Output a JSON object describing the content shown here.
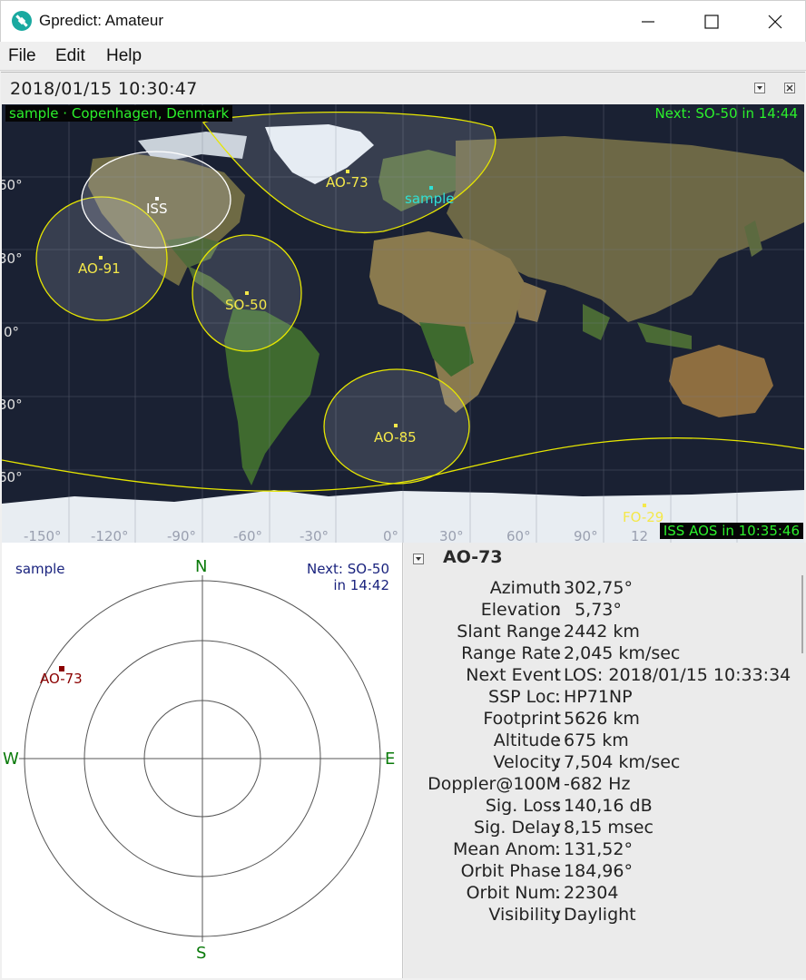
{
  "window": {
    "title": "Gpredict: Amateur"
  },
  "menu": [
    "File",
    "Edit",
    "Help"
  ],
  "module": {
    "time": "2018/01/15 10:30:47"
  },
  "map": {
    "qth_label": "sample · Copenhagen, Denmark",
    "next_event": "Next: SO-50 in 14:44",
    "aos_note": "ISS AOS in 10:35:46",
    "lat_ticks": [
      "60°",
      "30°",
      "0°",
      "30°",
      "60°"
    ],
    "lon_ticks": [
      "-150°",
      "-120°",
      "-90°",
      "-60°",
      "-30°",
      "0°",
      "30°",
      "60°",
      "90°",
      "12"
    ],
    "satellites": [
      {
        "name": "ISS",
        "color": "#ffffff"
      },
      {
        "name": "AO-73",
        "color": "#f4e84a"
      },
      {
        "name": "AO-91",
        "color": "#f4e84a"
      },
      {
        "name": "SO-50",
        "color": "#f4e84a"
      },
      {
        "name": "AO-85",
        "color": "#f4e84a"
      },
      {
        "name": "FO-29",
        "color": "#f4e84a"
      }
    ],
    "station": {
      "name": "sample",
      "color": "#2fe0d6"
    },
    "colors": {
      "overlay_text": "#2cf02c",
      "footprint": "#e6e600",
      "ocean": "#1a2133"
    }
  },
  "polar": {
    "station": "sample",
    "next_line1": "Next: SO-50",
    "next_line2": "in 14:42",
    "compass": {
      "n": "N",
      "s": "S",
      "e": "E",
      "w": "W"
    },
    "satellite": "AO-73",
    "colors": {
      "compass": "#0a7a0a",
      "sat": "#8b0000",
      "text": "#1a237e"
    }
  },
  "details": {
    "title": "AO-73",
    "rows": [
      {
        "label": "Azimuth",
        "value": "302,75°"
      },
      {
        "label": "Elevation",
        "value": "  5,73°"
      },
      {
        "label": "Slant Range",
        "value": "2442 km"
      },
      {
        "label": "Range Rate",
        "value": "2,045 km/sec"
      },
      {
        "label": "Next Event",
        "value": "LOS: 2018/01/15 10:33:34"
      },
      {
        "label": "SSP Loc.",
        "value": "HP71NP"
      },
      {
        "label": "Footprint",
        "value": "5626 km"
      },
      {
        "label": "Altitude",
        "value": "675 km"
      },
      {
        "label": "Velocity",
        "value": "7,504 km/sec"
      },
      {
        "label": "Doppler@100M",
        "value": "-682 Hz"
      },
      {
        "label": "Sig. Loss",
        "value": "140,16 dB"
      },
      {
        "label": "Sig. Delay",
        "value": "8,15 msec"
      },
      {
        "label": "Mean Anom.",
        "value": "131,52°"
      },
      {
        "label": "Orbit Phase",
        "value": "184,96°"
      },
      {
        "label": "Orbit Num.",
        "value": "22304"
      },
      {
        "label": "Visibility",
        "value": "Daylight"
      }
    ]
  }
}
